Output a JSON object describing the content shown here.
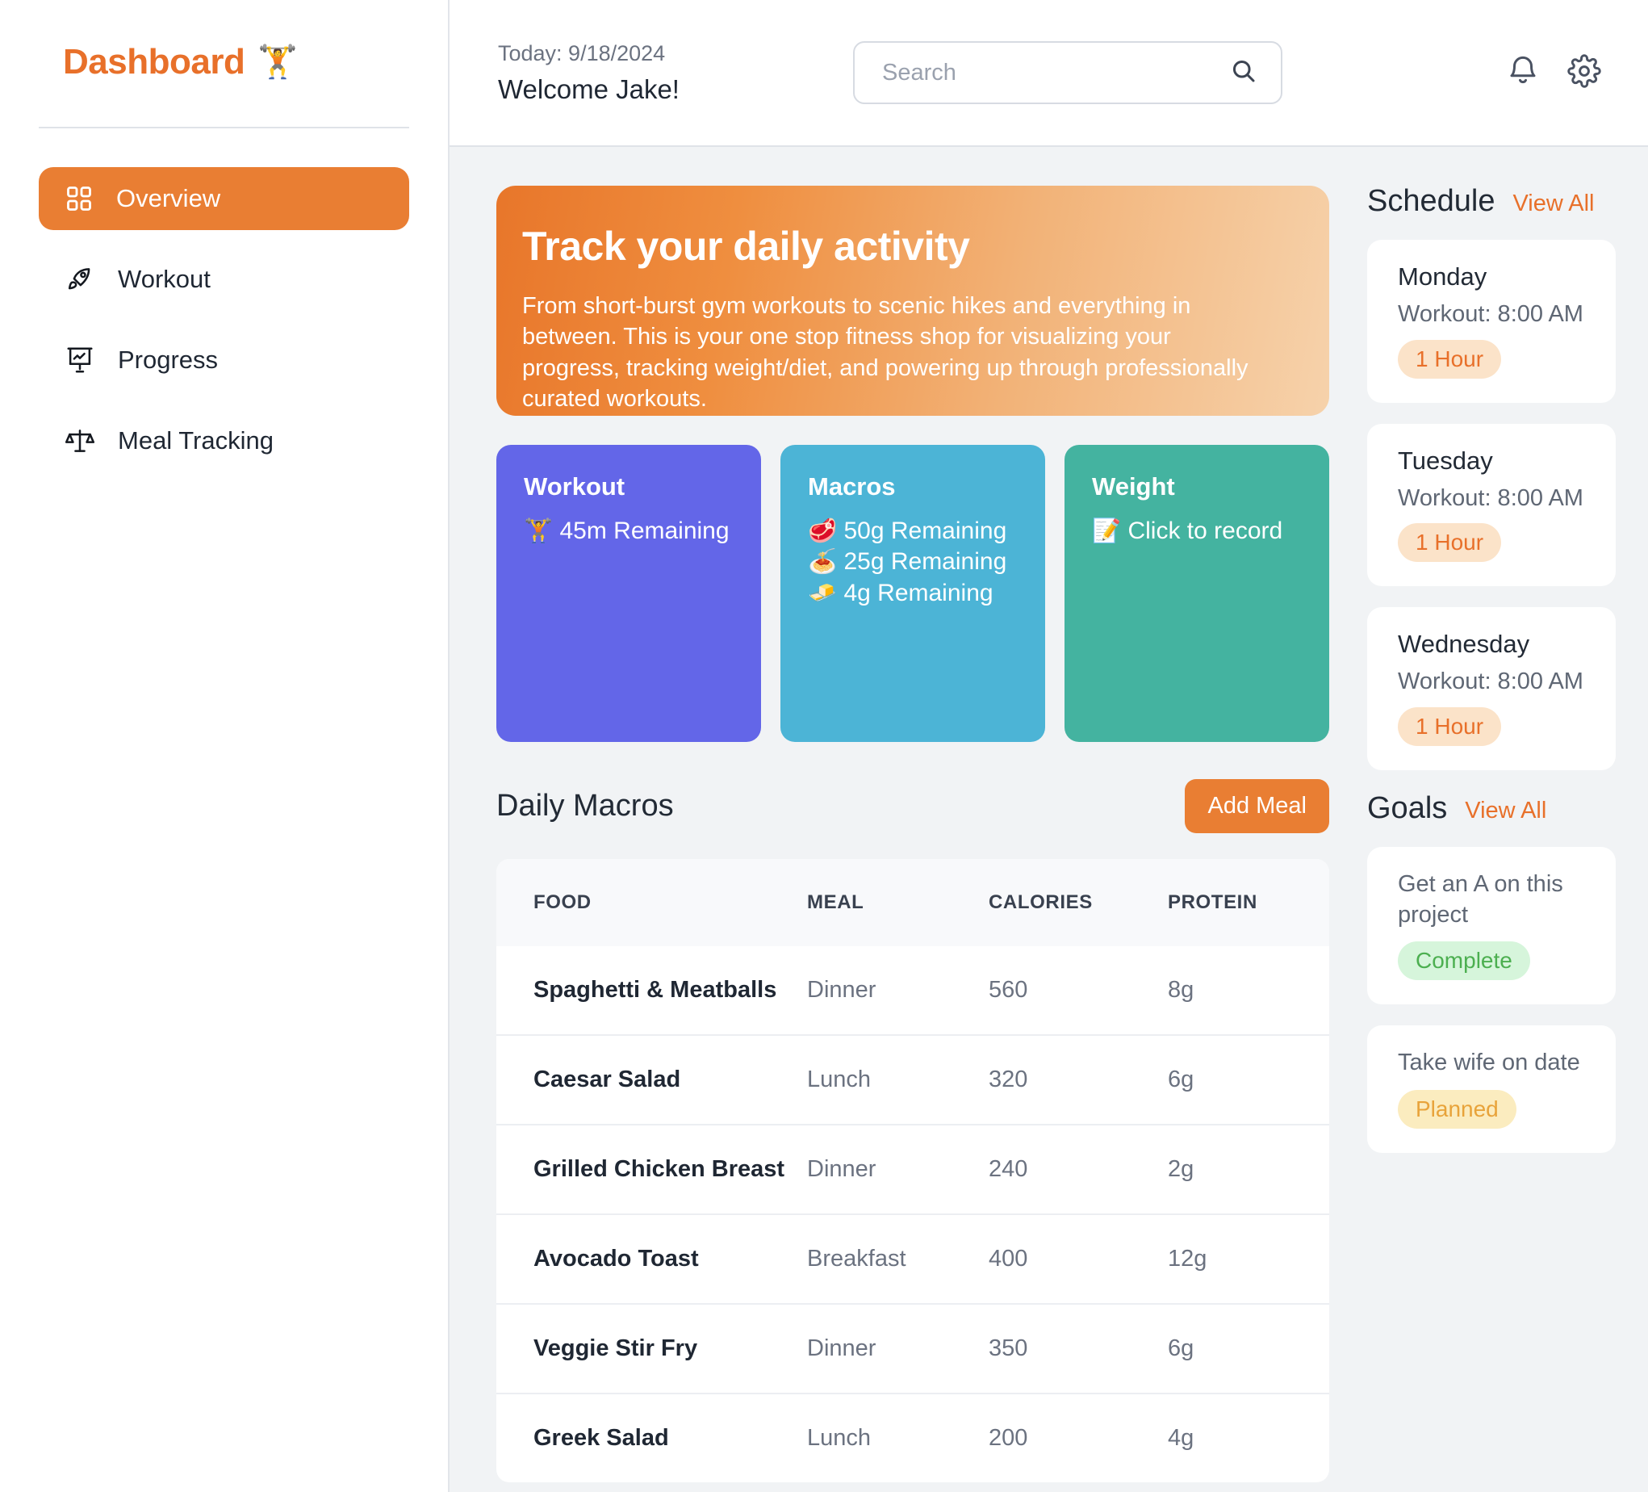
{
  "sidebar": {
    "brand_title": "Dashboard",
    "brand_emoji": "🏋️",
    "items": [
      {
        "label": "Overview",
        "icon": "grid-icon"
      },
      {
        "label": "Workout",
        "icon": "rocket-icon"
      },
      {
        "label": "Progress",
        "icon": "presentation-chart-icon"
      },
      {
        "label": "Meal Tracking",
        "icon": "scales-icon"
      }
    ]
  },
  "topbar": {
    "date_line": "Today: 9/18/2024",
    "welcome_line": "Welcome Jake!",
    "search_placeholder": "Search",
    "search_value": "",
    "search_icon": "search-icon",
    "bell_icon": "bell-icon",
    "gear_icon": "gear-icon"
  },
  "hero": {
    "title": "Track your daily activity",
    "body": "From short-burst gym workouts to scenic hikes and everything in between. This is your one stop fitness shop for visualizing your progress, tracking weight/diet, and powering up through professionally curated workouts."
  },
  "stats": [
    {
      "title": "Workout",
      "color": "#6366e8",
      "lines": [
        {
          "emoji": "🏋️",
          "text": "45m Remaining"
        }
      ]
    },
    {
      "title": "Macros",
      "color": "#4cb4d6",
      "lines": [
        {
          "emoji": "🥩",
          "text": "50g Remaining"
        },
        {
          "emoji": "🍝",
          "text": "25g Remaining"
        },
        {
          "emoji": "🧈",
          "text": "4g Remaining"
        }
      ]
    },
    {
      "title": "Weight",
      "color": "#44b3a0",
      "lines": [
        {
          "emoji": "📝",
          "text": "Click to record"
        }
      ]
    }
  ],
  "macros": {
    "section_title": "Daily Macros",
    "add_meal_label": "Add Meal",
    "columns": [
      "FOOD",
      "MEAL",
      "CALORIES",
      "PROTEIN"
    ],
    "rows": [
      {
        "food": "Spaghetti & Meatballs",
        "meal": "Dinner",
        "calories": "560",
        "protein": "8g"
      },
      {
        "food": "Caesar Salad",
        "meal": "Lunch",
        "calories": "320",
        "protein": "6g"
      },
      {
        "food": "Grilled Chicken Breast",
        "meal": "Dinner",
        "calories": "240",
        "protein": "2g"
      },
      {
        "food": "Avocado Toast",
        "meal": "Breakfast",
        "calories": "400",
        "protein": "12g"
      },
      {
        "food": "Veggie Stir Fry",
        "meal": "Dinner",
        "calories": "350",
        "protein": "6g"
      },
      {
        "food": "Greek Salad",
        "meal": "Lunch",
        "calories": "200",
        "protein": "4g"
      }
    ]
  },
  "schedule": {
    "title": "Schedule",
    "view_all": "View All",
    "cards": [
      {
        "day": "Monday",
        "detail": "Workout: 8:00 AM",
        "badge": "1 Hour"
      },
      {
        "day": "Tuesday",
        "detail": "Workout: 8:00 AM",
        "badge": "1 Hour"
      },
      {
        "day": "Wednesday",
        "detail": "Workout: 8:00 AM",
        "badge": "1 Hour"
      }
    ]
  },
  "goals": {
    "title": "Goals",
    "view_all": "View All",
    "cards": [
      {
        "text": "Get an A on this project",
        "badge": "Complete",
        "badge_style": "complete"
      },
      {
        "text": "Take wife on date",
        "badge": "Planned",
        "badge_style": "planned"
      }
    ]
  },
  "colors": {
    "accent": "#e8702a",
    "accent_button": "#e97e33",
    "content_bg": "#f1f3f5",
    "workout_card": "#6366e8",
    "macros_card": "#4cb4d6",
    "weight_card": "#44b3a0"
  }
}
